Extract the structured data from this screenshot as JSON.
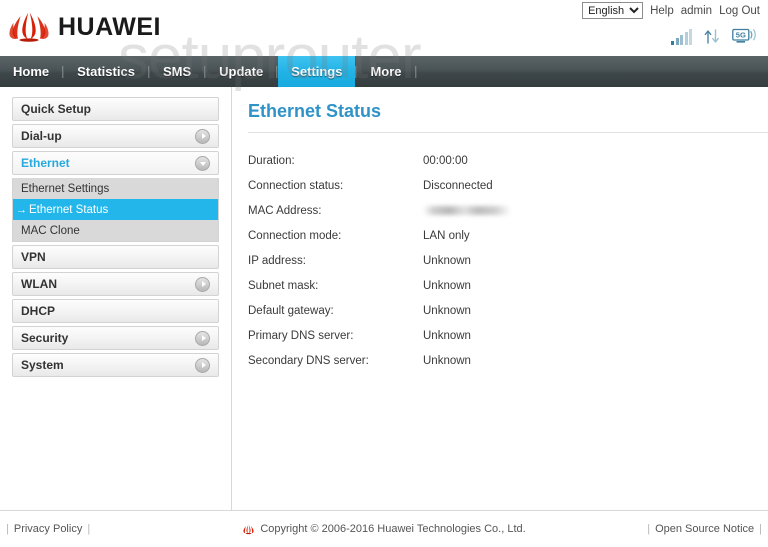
{
  "header": {
    "brand": "HUAWEI",
    "brand_color": "#d81e06",
    "language": {
      "selected": "English",
      "options": [
        "English"
      ]
    },
    "links": [
      {
        "label": "Help",
        "name": "help-link"
      },
      {
        "label": "admin",
        "name": "admin-link"
      },
      {
        "label": "Log Out",
        "name": "logout-link"
      }
    ],
    "status_icons": [
      {
        "name": "signal-strength-icon",
        "label": "signal-bars"
      },
      {
        "name": "data-transfer-icon",
        "label": "up-down-arrows"
      },
      {
        "name": "network-5g-icon",
        "label": "5G"
      }
    ]
  },
  "watermark": "setuprouter",
  "nav": {
    "active": "Settings",
    "accent_color": "#22b3e6",
    "items": [
      {
        "label": "Home",
        "name": "nav-home"
      },
      {
        "label": "Statistics",
        "name": "nav-statistics"
      },
      {
        "label": "SMS",
        "name": "nav-sms"
      },
      {
        "label": "Update",
        "name": "nav-update"
      },
      {
        "label": "Settings",
        "name": "nav-settings"
      },
      {
        "label": "More",
        "name": "nav-more"
      }
    ]
  },
  "sidebar": {
    "items": [
      {
        "label": "Quick Setup",
        "arrow": "none",
        "state": "closed"
      },
      {
        "label": "Dial-up",
        "arrow": "right",
        "state": "closed"
      },
      {
        "label": "Ethernet",
        "arrow": "down",
        "state": "open",
        "children": [
          {
            "label": "Ethernet Settings",
            "selected": false
          },
          {
            "label": "Ethernet Status",
            "selected": true
          },
          {
            "label": "MAC Clone",
            "selected": false
          }
        ]
      },
      {
        "label": "VPN",
        "arrow": "none",
        "state": "closed"
      },
      {
        "label": "WLAN",
        "arrow": "right",
        "state": "closed"
      },
      {
        "label": "DHCP",
        "arrow": "none",
        "state": "closed"
      },
      {
        "label": "Security",
        "arrow": "right",
        "state": "closed"
      },
      {
        "label": "System",
        "arrow": "right",
        "state": "closed"
      }
    ],
    "selected_arrow_glyph": "→"
  },
  "main": {
    "title": "Ethernet Status",
    "title_color": "#2f93c8",
    "rows": [
      {
        "key": "Duration:",
        "value": "00:00:00",
        "redacted": false
      },
      {
        "key": "Connection status:",
        "value": "Disconnected",
        "redacted": false
      },
      {
        "key": "MAC Address:",
        "value": "",
        "redacted": true
      },
      {
        "key": "Connection mode:",
        "value": "LAN only",
        "redacted": false
      },
      {
        "key": "IP address:",
        "value": "Unknown",
        "redacted": false
      },
      {
        "key": "Subnet mask:",
        "value": "Unknown",
        "redacted": false
      },
      {
        "key": "Default gateway:",
        "value": "Unknown",
        "redacted": false
      },
      {
        "key": "Primary DNS server:",
        "value": "Unknown",
        "redacted": false
      },
      {
        "key": "Secondary DNS server:",
        "value": "Unknown",
        "redacted": false
      }
    ]
  },
  "footer": {
    "privacy_policy": "Privacy Policy",
    "copyright": "Copyright © 2006-2016 Huawei Technologies Co., Ltd.",
    "open_source_notice": "Open Source Notice"
  }
}
